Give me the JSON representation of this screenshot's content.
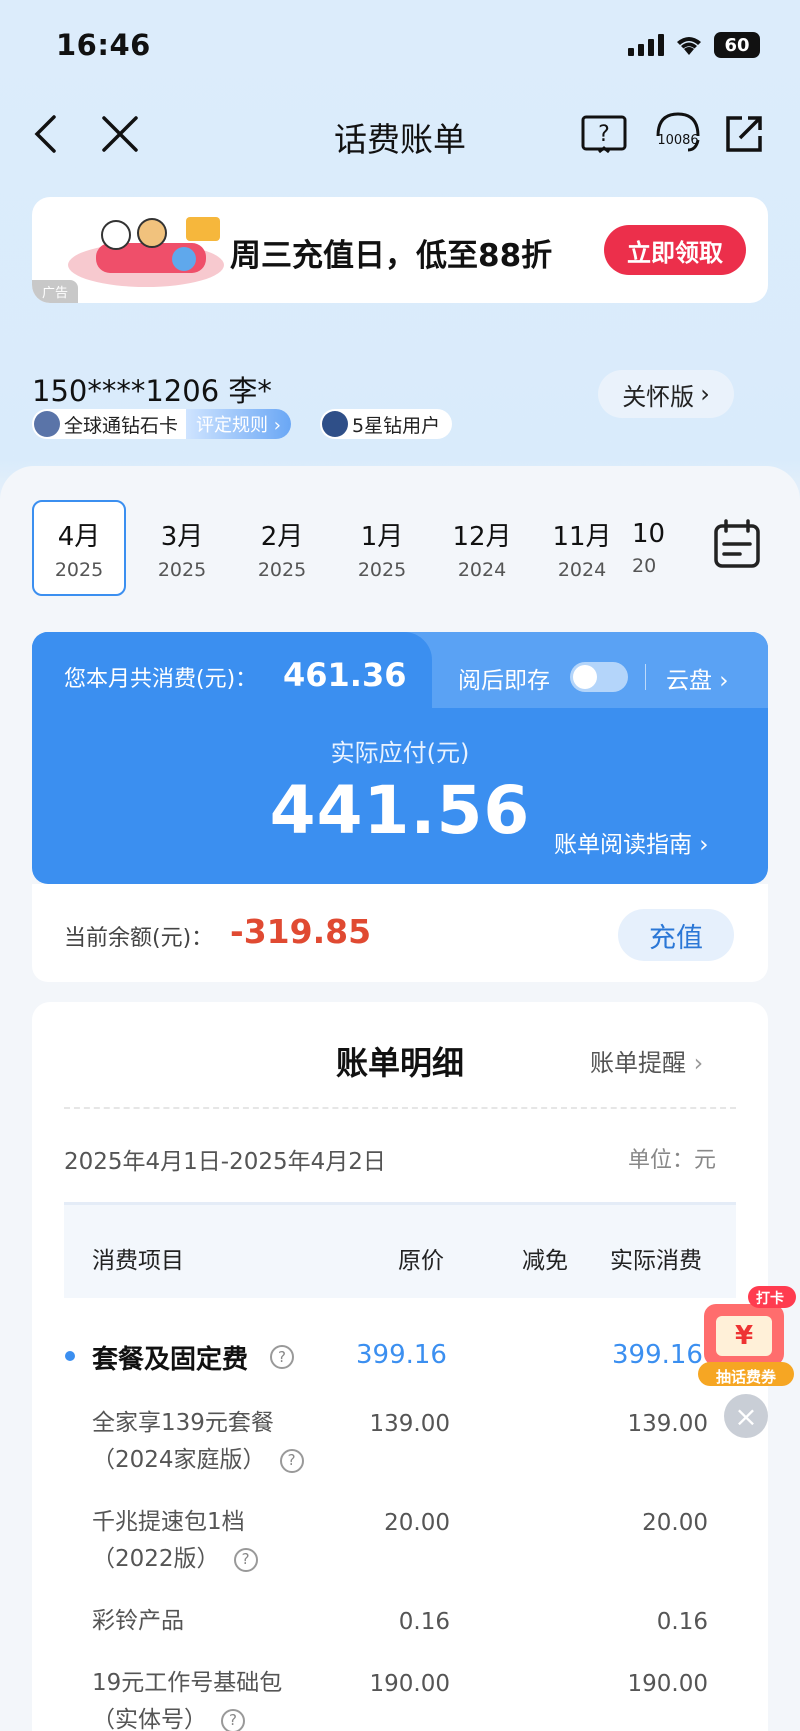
{
  "status": {
    "time": "16:46",
    "battery": "60"
  },
  "nav": {
    "title": "话费账单"
  },
  "ad": {
    "tag": "广告",
    "text": "周三充值日，低至88折",
    "button": "立即领取"
  },
  "user": {
    "phone": "150****1206 李*",
    "care_button": "关怀版",
    "card_name": "全球通钻石卡",
    "rule_link": "评定规则",
    "star_level": "5星钻用户"
  },
  "months": [
    {
      "m": "4月",
      "y": "2025",
      "active": true
    },
    {
      "m": "3月",
      "y": "2025"
    },
    {
      "m": "2月",
      "y": "2025"
    },
    {
      "m": "1月",
      "y": "2025"
    },
    {
      "m": "12月",
      "y": "2024"
    },
    {
      "m": "11月",
      "y": "2024"
    },
    {
      "m": "10",
      "y": "20"
    }
  ],
  "bill": {
    "total_label": "您本月共消费(元)：",
    "total_value": "461.36",
    "save_label": "阅后即存",
    "cloud": "云盘",
    "pay_label": "实际应付(元)",
    "pay_value": "441.56",
    "guide": "账单阅读指南"
  },
  "balance": {
    "label": "当前余额(元)：",
    "value": "-319.85",
    "button": "充值"
  },
  "detail": {
    "title": "账单明细",
    "remind": "账单提醒",
    "range": "2025年4月1日-2025年4月2日",
    "unit": "单位：元",
    "headers": [
      "消费项目",
      "原价",
      "减免",
      "实际消费"
    ],
    "category": {
      "name": "套餐及固定费",
      "original": "399.16",
      "actual": "399.16"
    },
    "items": [
      {
        "line1": "全家享139元套餐",
        "line2": "（2024家庭版）",
        "original": "139.00",
        "actual": "139.00"
      },
      {
        "line1": "千兆提速包1档",
        "line2": "（2022版）",
        "original": "20.00",
        "actual": "20.00"
      },
      {
        "line1": "彩铃产品",
        "line2": "",
        "original": "0.16",
        "actual": "0.16"
      },
      {
        "line1": "19元工作号基础包",
        "line2": "（实体号）",
        "original": "190.00",
        "actual": "190.00"
      }
    ]
  },
  "floating": {
    "top": "打卡",
    "bottom": "抽话费券"
  },
  "colors": {
    "accent": "#3b8ff0",
    "negative": "#e04a32",
    "ad_button": "#ec2f4b"
  }
}
